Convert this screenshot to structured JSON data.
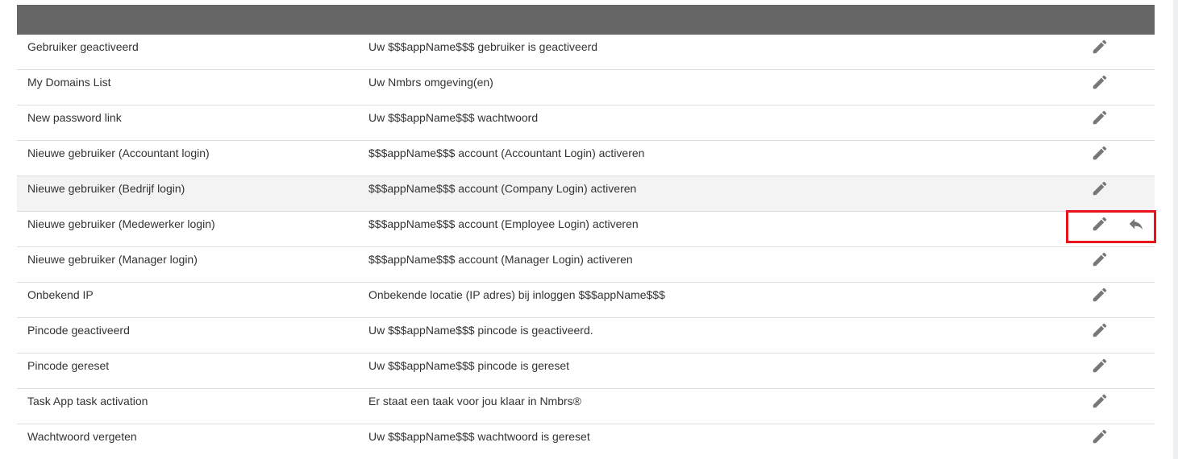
{
  "table": {
    "columns": [
      "",
      "",
      ""
    ],
    "rows": [
      {
        "name": "Gebruiker geactiveerd",
        "subject": "Uw $$$appName$$$ gebruiker is geactiveerd",
        "edit_icon": "pencil-icon",
        "reset": false
      },
      {
        "name": "My Domains List",
        "subject": "Uw Nmbrs omgeving(en)",
        "edit_icon": "pencil-icon",
        "reset": false
      },
      {
        "name": "New password link",
        "subject": "Uw $$$appName$$$ wachtwoord",
        "edit_icon": "pencil-icon",
        "reset": false
      },
      {
        "name": "Nieuwe gebruiker (Accountant login)",
        "subject": "$$$appName$$$ account (Accountant Login) activeren",
        "edit_icon": "pencil-icon",
        "reset": false
      },
      {
        "name": "Nieuwe gebruiker (Bedrijf login)",
        "subject": "$$$appName$$$ account (Company Login) activeren",
        "edit_icon": "pencil-icon",
        "reset": false
      },
      {
        "name": "Nieuwe gebruiker (Medewerker login)",
        "subject": "$$$appName$$$ account (Employee Login) activeren",
        "edit_icon": "pencil-icon",
        "reset": true,
        "reset_icon": "undo-arrow-icon"
      },
      {
        "name": "Nieuwe gebruiker (Manager login)",
        "subject": "$$$appName$$$ account (Manager Login) activeren",
        "edit_icon": "pencil-icon",
        "reset": false
      },
      {
        "name": "Onbekend IP",
        "subject": "Onbekende locatie (IP adres) bij inloggen $$$appName$$$",
        "edit_icon": "pencil-icon",
        "reset": false
      },
      {
        "name": "Pincode geactiveerd",
        "subject": "Uw $$$appName$$$ pincode is geactiveerd.",
        "edit_icon": "pencil-icon",
        "reset": false
      },
      {
        "name": "Pincode gereset",
        "subject": "Uw $$$appName$$$ pincode is gereset",
        "edit_icon": "pencil-icon",
        "reset": false
      },
      {
        "name": "Task App task activation",
        "subject": "Er staat een taak voor jou klaar in Nmbrs®",
        "edit_icon": "pencil-icon",
        "reset": false
      },
      {
        "name": "Wachtwoord vergeten",
        "subject": "Uw $$$appName$$$ wachtwoord is gereset",
        "edit_icon": "pencil-icon",
        "reset": false
      }
    ]
  },
  "colors": {
    "header_bg": "#666666",
    "icon": "#777777",
    "highlight": "#e8141b",
    "row_hover": "#f3f3f3"
  }
}
